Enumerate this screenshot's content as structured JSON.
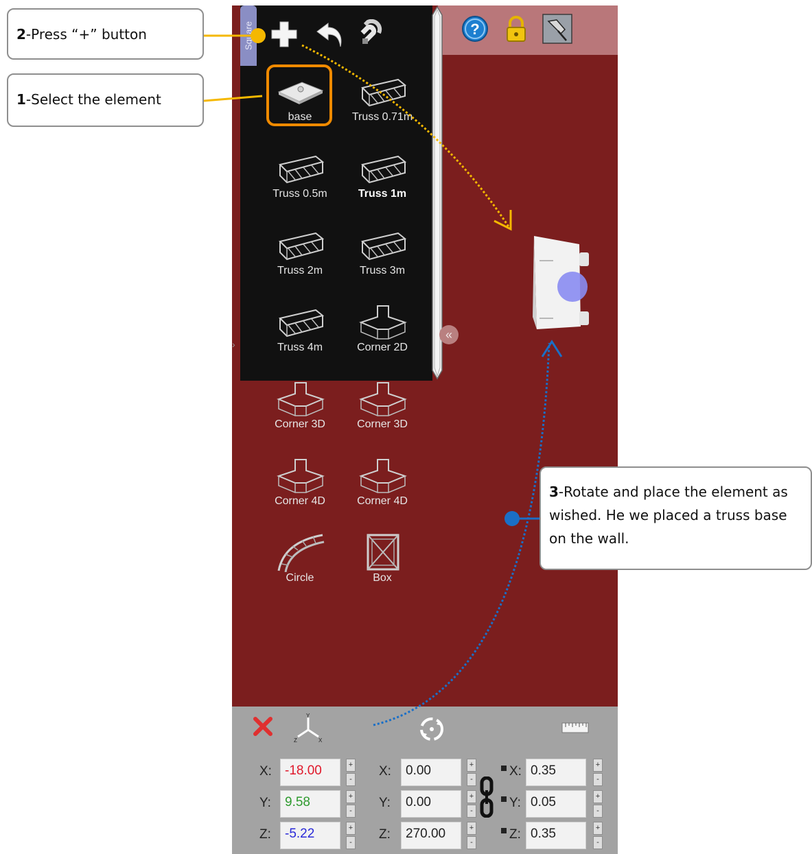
{
  "library": {
    "category_tab": "Square",
    "items": [
      {
        "label": "base"
      },
      {
        "label": "Truss 0.71m"
      },
      {
        "label": "Truss 0.5m"
      },
      {
        "label": "Truss 1m"
      },
      {
        "label": "Truss 2m"
      },
      {
        "label": "Truss 3m"
      },
      {
        "label": "Truss 4m"
      },
      {
        "label": "Corner 2D"
      },
      {
        "label": "Corner 3D"
      },
      {
        "label": "Corner 3D"
      },
      {
        "label": "Corner 4D"
      },
      {
        "label": "Corner 4D"
      },
      {
        "label": "Circle"
      },
      {
        "label": "Box"
      }
    ]
  },
  "panel": {
    "position": {
      "x_label": "X:",
      "y_label": "Y:",
      "z_label": "Z:",
      "x": "-18.00",
      "y": "9.58",
      "z": "-5.22"
    },
    "rotation": {
      "x_label": "X:",
      "y_label": "Y:",
      "z_label": "Z:",
      "x": "0.00",
      "y": "0.00",
      "z": "270.00"
    },
    "scale": {
      "x_label": "X:",
      "y_label": "Y:",
      "z_label": "Z:",
      "x": "0.35",
      "y": "0.05",
      "z": "0.35"
    },
    "stepper_plus": "+",
    "stepper_minus": "-",
    "value_colors": {
      "x": "#e0182a",
      "y": "#2e9a2e",
      "z": "#2a2ad8"
    }
  },
  "callouts": {
    "step2": {
      "num": "2",
      "text": "-Press “+” button"
    },
    "step1": {
      "num": "1",
      "text": "-Select the element"
    },
    "step3": {
      "num": "3",
      "text": "-Rotate and place the element as wished. He we placed a truss base on the wall."
    }
  },
  "colors": {
    "accent_orange": "#f5b800",
    "accent_blue": "#1a6fc7",
    "wall": "#7b1e1e",
    "selection": "#f08a00"
  }
}
